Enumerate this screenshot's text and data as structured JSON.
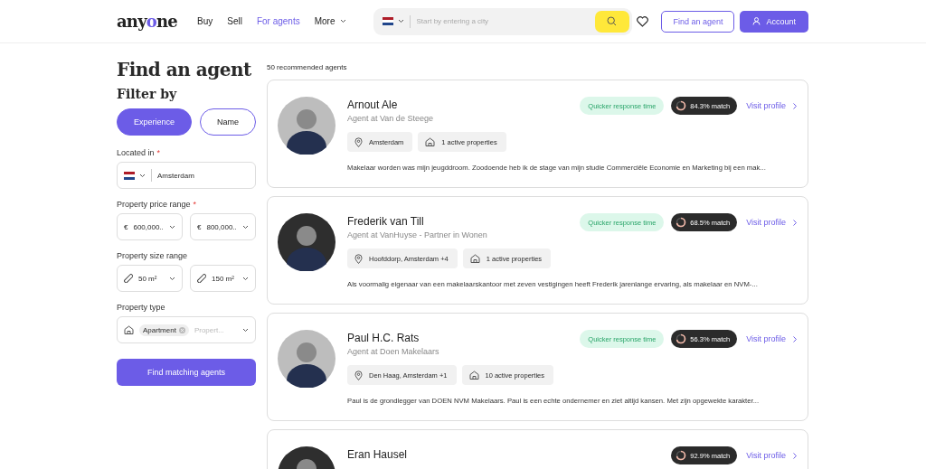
{
  "header": {
    "logo": [
      "any",
      "o",
      "ne"
    ],
    "nav": [
      {
        "label": "Buy",
        "selected": false,
        "dropdown": false
      },
      {
        "label": "Sell",
        "selected": false,
        "dropdown": false
      },
      {
        "label": "For agents",
        "selected": true,
        "dropdown": false
      },
      {
        "label": "More",
        "selected": false,
        "dropdown": true
      }
    ],
    "search": {
      "placeholder": "Start by entering a city"
    },
    "find_button": "Find an agent",
    "account_button": "Account"
  },
  "filters": {
    "title": "Find an agent",
    "heading": "Filter by",
    "modes": [
      {
        "label": "Experience",
        "selected": true
      },
      {
        "label": "Name",
        "selected": false
      }
    ],
    "fields": [
      {
        "kind": "location",
        "label": "Located in",
        "required_mark": "*",
        "value": "Amsterdam"
      },
      {
        "kind": "price",
        "label": "Property price range",
        "required_mark": "*",
        "prefix": "€",
        "values": [
          "600,000..",
          "800,000.."
        ]
      },
      {
        "kind": "size",
        "label": "Property size range",
        "values": [
          "50 m²",
          "150 m²"
        ]
      },
      {
        "kind": "type",
        "label": "Property type",
        "tag": "Apartment",
        "placeholder": "Propert..."
      }
    ],
    "submit": "Find matching agents"
  },
  "results": {
    "count": "50 recommended agents",
    "agents": [
      {
        "name": "Arnout Ale",
        "role": "Agent at Van de Steege",
        "badge": "Quicker response time",
        "match": "84.3% match",
        "link": "Visit profile",
        "location": "Amsterdam",
        "properties": "1 active properties",
        "bio": "Makelaar worden was mijn jeugddroom. Zoodoende heb ik de stage van mijn studie Commerciële Economie en Marketing bij een mak..."
      },
      {
        "name": "Frederik van Till",
        "role": "Agent at VanHuyse - Partner in Wonen",
        "badge": "Quicker response time",
        "match": "68.5% match",
        "link": "Visit profile",
        "location": "Hoofddorp, Amsterdam +4",
        "properties": "1 active properties",
        "bio": "Als voormalig eigenaar van een makelaarskantoor met zeven vestigingen heeft Frederik jarenlange ervaring, als makelaar en NVM-..."
      },
      {
        "name": "Paul H.C. Rats",
        "role": "Agent at Doen Makelaars",
        "badge": "Quicker response time",
        "match": "56.3% match",
        "link": "Visit profile",
        "location": "Den Haag, Amsterdam +1",
        "properties": "10 active properties",
        "bio": "Paul is de grondlegger van DOEN NVM Makelaars. Paul is een echte ondernemer en ziet altijd kansen. Met zijn opgewekte karakter..."
      },
      {
        "name": "Eran Hausel",
        "match": "92.9% match",
        "link": "Visit profile"
      }
    ]
  }
}
